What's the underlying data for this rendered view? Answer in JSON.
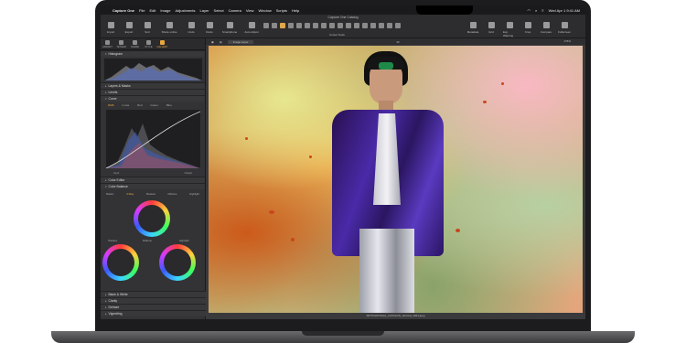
{
  "menubar": {
    "app": "Capture One",
    "items": [
      "File",
      "Edit",
      "Image",
      "Adjustments",
      "Layer",
      "Select",
      "Camera",
      "View",
      "Window",
      "Scripts",
      "Help"
    ],
    "datetime": "Wed Apr 1  9:41 AM"
  },
  "toolbar": {
    "window_title": "Capture One Catalog",
    "left_buttons": [
      "Import",
      "Export",
      "Sort",
      "Share online",
      "Undo",
      "Redo",
      "Smartphone",
      "Auto Adjust"
    ],
    "right_buttons": [
      "Metadata",
      "Grid",
      "Exp. Warning",
      "Crop",
      "Compare",
      "Fullscreen"
    ],
    "cursor_label": "Cursor Tools"
  },
  "left_panel": {
    "tabs": [
      "LIBRARY",
      "TETHER",
      "SHARE",
      "STYLE",
      "GALLERY"
    ],
    "active_tab": "GALLERY",
    "sections": {
      "histogram": "Histogram",
      "layers": "Layers & Masks",
      "levels": "Levels",
      "curve": "Curve",
      "color_editor": "Color Editor",
      "color_balance": "Color Balance",
      "bw": "Black & White",
      "clarity": "Clarity",
      "dehaze": "Dehaze",
      "vignetting": "Vignetting"
    },
    "curve_tabs": [
      "RGB",
      "Luma",
      "Red",
      "Green",
      "Blue"
    ],
    "curve_input": "Input",
    "curve_output": "Output",
    "color_balance_tabs": [
      "Master",
      "3-Way",
      "Shadow",
      "Midtone",
      "Highlight"
    ],
    "wheel_labels": {
      "midtone": "Midtone",
      "shadow": "Shadow",
      "highlight": "Highlight"
    }
  },
  "viewer": {
    "layer": "Image Layer",
    "zoom": "176%",
    "page": "32",
    "filename": "MOTIVATIONAL_CATALOG_Vertical_2024.jpeg"
  },
  "colors": {
    "accent": "#e8a840",
    "jacket": "#4a2aa8",
    "background": "#2d2d30"
  }
}
